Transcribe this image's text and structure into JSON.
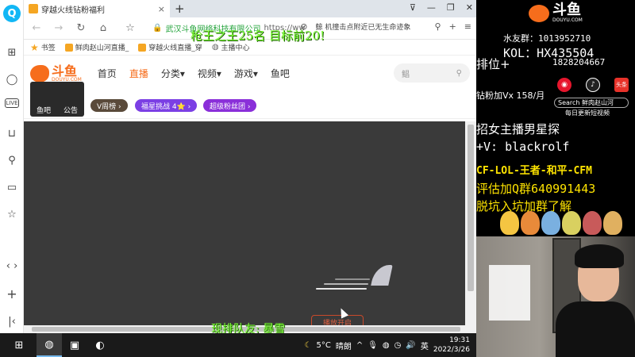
{
  "browser": {
    "tab_title": "穿越火线钻粉福利",
    "tab_close": "×",
    "new_tab": "+",
    "window_controls": [
      "⊽",
      "—",
      "❐",
      "✕"
    ],
    "nav": {
      "back": "←",
      "forward": "→",
      "refresh": "↻",
      "home": "⌂"
    },
    "url_site": "武汉斗鱼网络科技有限公司",
    "url_text": "https://ww",
    "news_ticker": "鲸 机撞击点附近已无生命迹象",
    "bookmarks": [
      "书签",
      "鲜肉赵山河直播_",
      "穿越火线直播_穿",
      "主播中心"
    ]
  },
  "site": {
    "logo_cn": "斗鱼",
    "logo_en": "DOUYU.COM",
    "nav_items": [
      "首页",
      "直播",
      "分类▾",
      "视频▾",
      "游戏▾",
      "鱼吧"
    ],
    "search_placeholder": "鲳",
    "search_icon": "⚲",
    "anchor_links": [
      "鱼吧",
      "公告"
    ],
    "badges": {
      "week": "V周榜 ›",
      "star": "福星挑战  4⭐ ›",
      "super": "超级粉丝团 ›"
    },
    "player_button": "播放开启"
  },
  "overlay": {
    "top": "枪王之王25名  目标前20!",
    "bottom": "现排队友:  暴雪"
  },
  "panel": {
    "logo_cn": "斗鱼",
    "logo_en": "DOUYU.COM",
    "water_group": "水友群：1013952710",
    "kol": "KOL：HX435504",
    "rank": "排位+",
    "rank_number": "1828204667",
    "diamond": "钻粉加Vx 158/月",
    "search_text": "Search 鲜肉赵山河",
    "daily_update": "每日更新短视频",
    "recruit": "招女主播男星探",
    "wechat": "+V: blackrolf",
    "games": "CF-LOL-王者-和平-CFM",
    "eval": "评估加Q群640991443",
    "join": "脱坑入坑加群了解"
  },
  "taskbar": {
    "weather_temp": "5°C",
    "weather_desc": "晴朗",
    "lang": "英",
    "time": "19:31",
    "date": "2022/3/26",
    "tray_up": "^"
  }
}
